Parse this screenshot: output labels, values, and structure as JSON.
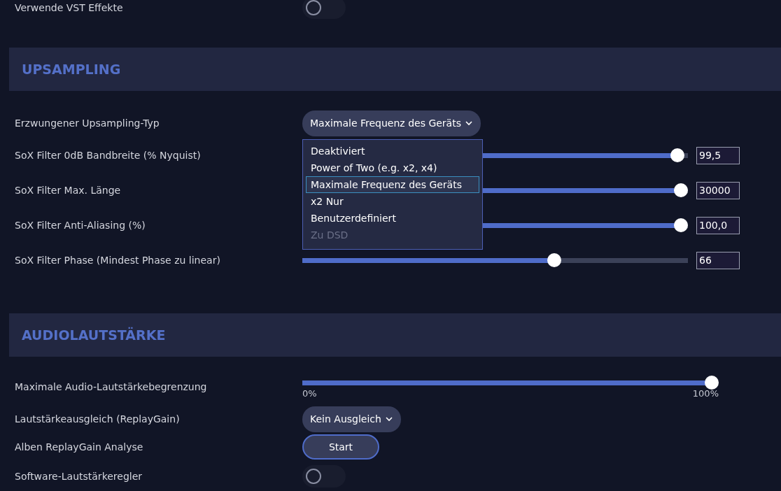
{
  "top_rows": [
    {
      "kind": "toggle",
      "label": "Verwende VST Effekte",
      "on": false
    }
  ],
  "sections": [
    {
      "title": "UPSAMPLING",
      "rows": [
        {
          "kind": "select",
          "label": "Erzwungener Upsampling-Typ",
          "value": "Maximale Frequenz des Geräts",
          "options": [
            {
              "label": "Deaktiviert",
              "selected": false,
              "disabled": false
            },
            {
              "label": "Power of Two (e.g. x2, x4)",
              "selected": false,
              "disabled": false
            },
            {
              "label": "Maximale Frequenz des Geräts",
              "selected": true,
              "disabled": false
            },
            {
              "label": "x2 Nur",
              "selected": false,
              "disabled": false
            },
            {
              "label": "Benutzerdefiniert",
              "selected": false,
              "disabled": false
            },
            {
              "label": "Zu DSD",
              "selected": false,
              "disabled": true
            }
          ]
        },
        {
          "kind": "slider",
          "label": "SoX Filter 0dB Bandbreite (% Nyquist)",
          "level": 0.99,
          "value": "99,5"
        },
        {
          "kind": "slider",
          "label": "SoX Filter Max. Länge",
          "level": 1,
          "value": "30000"
        },
        {
          "kind": "slider",
          "label": "SoX Filter Anti-Aliasing (%)",
          "level": 1,
          "value": "100,0"
        },
        {
          "kind": "slider",
          "label": "SoX Filter Phase (Mindest Phase zu linear)",
          "level": 0.66,
          "value": "66"
        }
      ]
    },
    {
      "title": "AUDIOLAUTSTÄRKE",
      "rows": [
        {
          "kind": "range",
          "label": "Maximale Audio-Lautstärkebegrenzung",
          "level": 1,
          "min_label": "0%",
          "max_label": "100%"
        },
        {
          "kind": "select",
          "label": "Lautstärkeausgleich (ReplayGain)",
          "value": "Kein Ausgleich"
        },
        {
          "kind": "button",
          "label": "Alben ReplayGain Analyse",
          "button": "Start"
        },
        {
          "kind": "toggle",
          "label": "Software-Lautstärkeregler",
          "on": false
        }
      ]
    }
  ]
}
